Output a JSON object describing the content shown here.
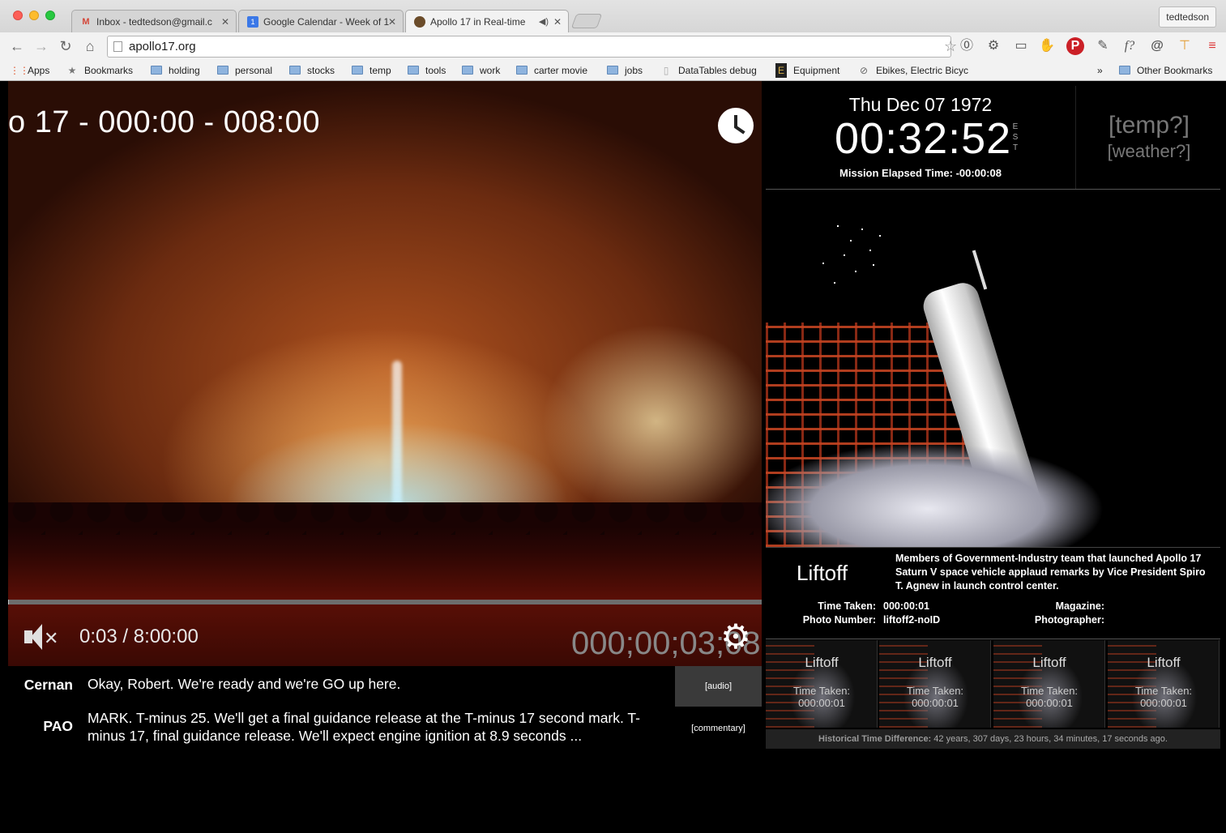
{
  "browser": {
    "tabs": [
      {
        "label": "Inbox - tedtedson@gmail.c",
        "icon": "gmail-icon"
      },
      {
        "label": "Google Calendar - Week of 1",
        "icon": "calendar-icon"
      },
      {
        "label": "Apollo 17 in Real-time",
        "icon": "apollo-icon"
      }
    ],
    "profile": "tedtedson",
    "url": "apollo17.org",
    "bookmarks": [
      {
        "label": "Apps",
        "kind": "apps"
      },
      {
        "label": "Bookmarks",
        "kind": "star"
      },
      {
        "label": "holding",
        "kind": "folder"
      },
      {
        "label": "personal",
        "kind": "folder"
      },
      {
        "label": "stocks",
        "kind": "folder"
      },
      {
        "label": "temp",
        "kind": "folder"
      },
      {
        "label": "tools",
        "kind": "folder"
      },
      {
        "label": "work",
        "kind": "folder"
      },
      {
        "label": "carter movie",
        "kind": "folder"
      },
      {
        "label": "jobs",
        "kind": "folder"
      },
      {
        "label": "DataTables debug",
        "kind": "page"
      },
      {
        "label": "Equipment",
        "kind": "page"
      },
      {
        "label": "Ebikes, Electric Bicyc",
        "kind": "page"
      },
      {
        "label": "»",
        "kind": "more"
      },
      {
        "label": "Other Bookmarks",
        "kind": "folder"
      }
    ]
  },
  "video": {
    "title": "o 17 - 000:00 - 008:00",
    "time_readout": "0:03 / 8:00:00",
    "timecode": "000;00;03;08",
    "progress_fraction": 0.0001
  },
  "transcript": [
    {
      "speaker": "Cernan",
      "text": "Okay, Robert. We're ready and we're GO up here."
    },
    {
      "speaker": "PAO",
      "text": "MARK. T-minus 25. We'll get a final guidance release at the T-minus 17 second mark. T-minus 17, final guidance release. We'll expect engine ignition at 8.9 seconds ..."
    }
  ],
  "side_buttons": {
    "audio": "[audio]",
    "commentary": "[commentary]"
  },
  "clock": {
    "date": "Thu Dec 07 1972",
    "time": "00:32:52",
    "timezone_letters": [
      "E",
      "S",
      "T"
    ],
    "met": "Mission Elapsed Time: -00:00:08",
    "temp": "[temp?]",
    "weather": "[weather?]"
  },
  "photo": {
    "title": "Liftoff",
    "description": "Members of Government-Industry team that launched Apollo 17 Saturn V space vehicle applaud remarks by Vice President Spiro T. Agnew in launch control center.",
    "time_taken_label": "Time Taken:",
    "time_taken": "000:00:01",
    "photo_number_label": "Photo Number:",
    "photo_number": "liftoff2-noID",
    "magazine_label": "Magazine:",
    "photographer_label": "Photographer:"
  },
  "thumbnails": [
    {
      "title": "Liftoff",
      "label": "Time Taken:",
      "value": "000:00:01"
    },
    {
      "title": "Liftoff",
      "label": "Time Taken:",
      "value": "000:00:01"
    },
    {
      "title": "Liftoff",
      "label": "Time Taken:",
      "value": "000:00:01"
    },
    {
      "title": "Liftoff",
      "label": "Time Taken:",
      "value": "000:00:01"
    }
  ],
  "historical": {
    "label": "Historical Time Difference:",
    "value": "42 years, 307 days, 23 hours, 34 minutes, 17 seconds ago."
  }
}
